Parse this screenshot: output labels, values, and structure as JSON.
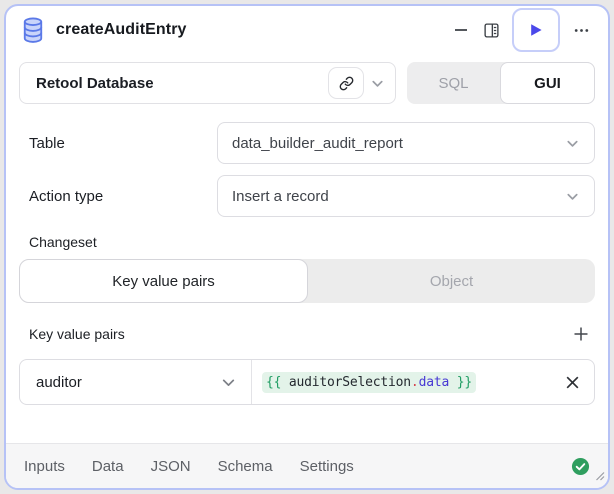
{
  "header": {
    "title": "createAuditEntry"
  },
  "resource": {
    "name": "Retool Database"
  },
  "mode_toggle": {
    "options": [
      "SQL",
      "GUI"
    ],
    "selected": "GUI"
  },
  "fields": [
    {
      "label": "Table",
      "value": "data_builder_audit_report"
    },
    {
      "label": "Action type",
      "value": "Insert a record"
    }
  ],
  "changeset": {
    "label": "Changeset",
    "options": [
      "Key value pairs",
      "Object"
    ],
    "selected": "Key value pairs"
  },
  "kv_section": {
    "label": "Key value pairs",
    "rows": [
      {
        "key": "auditor",
        "value_tokens": [
          {
            "text": "{{ ",
            "color": "#1f9d63"
          },
          {
            "text": "auditorSelection",
            "color": "#24292f"
          },
          {
            "text": ".",
            "color": "#d6434e"
          },
          {
            "text": "data",
            "color": "#4839d4"
          },
          {
            "text": " }}",
            "color": "#1f9d63"
          }
        ]
      }
    ]
  },
  "footer": {
    "tabs": [
      "Inputs",
      "Data",
      "JSON",
      "Schema",
      "Settings"
    ]
  },
  "icons": {
    "query_type": "database-icon",
    "minimize": "minus-icon",
    "side_panel": "panel-icon",
    "run": "play-icon",
    "more": "ellipsis-icon",
    "resource_link": "link-icon",
    "dropdown": "chevron-down-icon",
    "add_pair": "plus-icon",
    "remove_pair": "close-icon",
    "status": "check-circle-icon",
    "resize": "resize-handle-icon"
  },
  "colors": {
    "panel_border": "#b6c2f6",
    "play_accent": "#4b48ea",
    "db_icon_fill": "#c9d4fa",
    "db_icon_stroke": "#5b79e8",
    "code_highlight_bg": "#e3f3e9",
    "status_green": "#2f9e5f",
    "footer_bg": "#f6f6f7"
  }
}
